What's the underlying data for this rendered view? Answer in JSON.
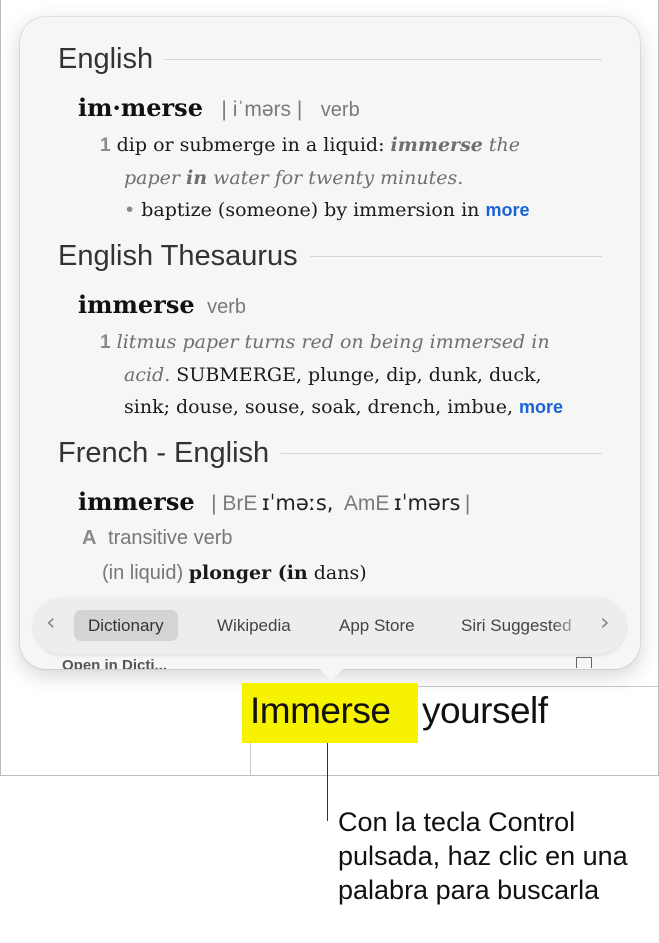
{
  "sections": {
    "english": {
      "header": "English",
      "headword": "im·merse",
      "pronunciation": "| iˈmərs |",
      "pos": "verb",
      "sense_num": "1",
      "definition": "dip or submerge in a liquid",
      "colon": ":",
      "ex_part1": "immerse",
      "ex_part2": " the",
      "ex_line2_a": "paper ",
      "ex_line2_b": "in",
      "ex_line2_c": " water for twenty minutes.",
      "bullet": "•",
      "subsense": "baptize (someone) by immersion in",
      "more": "more"
    },
    "thesaurus": {
      "header": "English Thesaurus",
      "headword": "immerse",
      "pos": "verb",
      "sense_num": "1",
      "example_line1": "litmus paper turns red on being immersed in",
      "example_line2": "acid.",
      "syn_line1": "SUBMERGE, plunge, dip, dunk, duck,",
      "syn_line2": "sink; douse, souse, soak, drench, imbue,",
      "more": "more"
    },
    "french": {
      "header": "French - English",
      "headword": "immerse",
      "pron_open": "| BrE",
      "ipa_bre": "ɪˈməːs,",
      "label_ame": "AmE",
      "ipa_ame": "ɪˈmərs",
      "pron_close": "|",
      "sense_letter": "A",
      "sense_label": "transitive verb",
      "gloss_a": "(in liquid) ",
      "gloss_b": "plonger (",
      "gloss_c": "in",
      "gloss_d": " dans)"
    }
  },
  "tabs": [
    {
      "label": "Dictionary",
      "selected": true
    },
    {
      "label": "Wikipedia",
      "selected": false
    },
    {
      "label": "App Store",
      "selected": false
    },
    {
      "label": "Siri Suggested",
      "selected": false
    }
  ],
  "behind_text": "Open in Dicti...",
  "document": {
    "highlighted_word": "Immerse",
    "rest": "yourself"
  },
  "callout": "Con la tecla Control pulsada, haz clic en una palabra para buscarla",
  "colors": {
    "highlight": "#f6f200",
    "link": "#1a64d6"
  }
}
